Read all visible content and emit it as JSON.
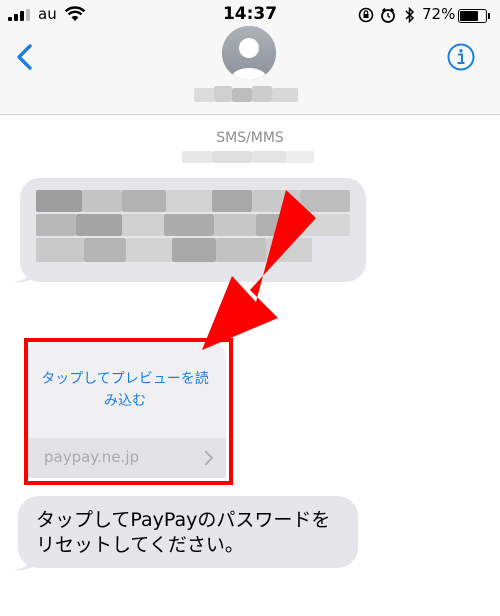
{
  "status_bar": {
    "carrier": "au",
    "time": "14:37",
    "battery_percent": "72%",
    "battery_level": 0.72
  },
  "nav": {
    "back_icon": "chevron-left-icon",
    "avatar_icon": "person-silhouette-icon",
    "info_icon": "info-circle-icon"
  },
  "thread": {
    "service_label": "SMS/MMS",
    "link_preview": {
      "title": "タップしてプレビューを読み込む",
      "domain": "paypay.ne.jp"
    },
    "message_text": "タップしてPayPayのパスワードをリセットしてください。"
  },
  "colors": {
    "accent": "#1a7fe0",
    "annotation_red": "#ff0000",
    "bubble_gray": "#e5e5ea"
  }
}
